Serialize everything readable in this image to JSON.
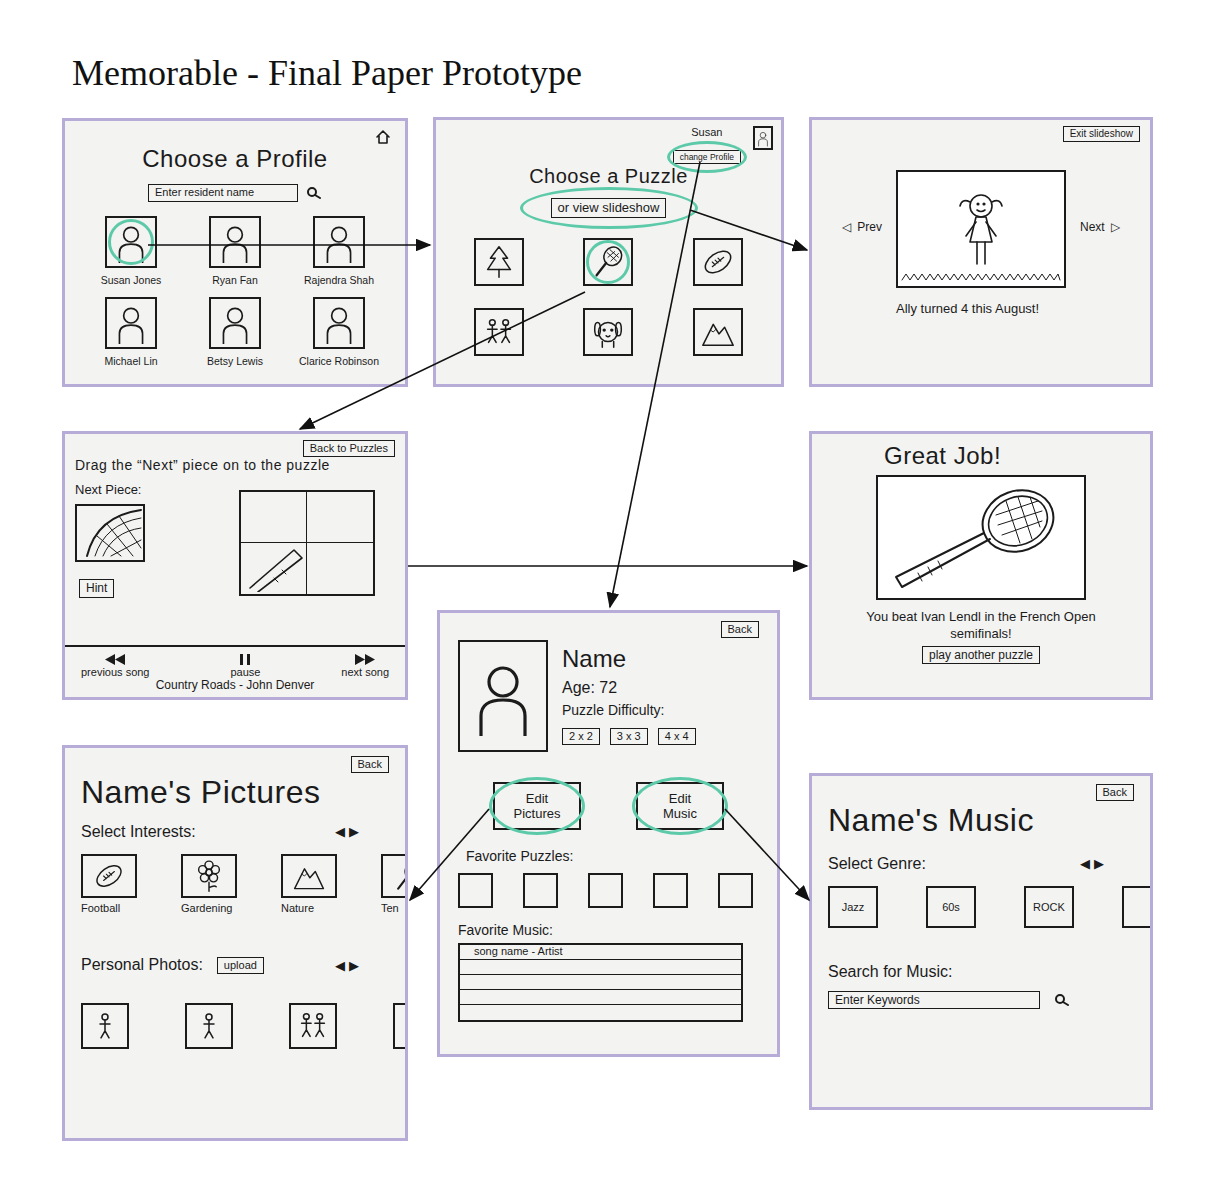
{
  "title": "Memorable - Final Paper Prototype",
  "profiles_screen": {
    "heading": "Choose a Profile",
    "search_placeholder": "Enter resident name",
    "profiles": [
      {
        "name": "Susan Jones",
        "highlighted": true
      },
      {
        "name": "Ryan Fan",
        "highlighted": false
      },
      {
        "name": "Rajendra Shah",
        "highlighted": false
      },
      {
        "name": "Michael Lin",
        "highlighted": false
      },
      {
        "name": "Betsy Lewis",
        "highlighted": false
      },
      {
        "name": "Clarice Robinson",
        "highlighted": false
      }
    ]
  },
  "puzzles_screen": {
    "user": "Susan",
    "change_profile": {
      "label": "change Profile",
      "highlighted": true
    },
    "heading": "Choose a Puzzle",
    "slideshow_link": {
      "label": "or view slideshow",
      "highlighted": true
    },
    "puzzles": [
      {
        "kind": "tree",
        "highlighted": false
      },
      {
        "kind": "tennis",
        "highlighted": true
      },
      {
        "kind": "football",
        "highlighted": false
      },
      {
        "kind": "people",
        "highlighted": false
      },
      {
        "kind": "dog",
        "highlighted": false
      },
      {
        "kind": "mountain",
        "highlighted": false
      }
    ]
  },
  "slideshow_screen": {
    "exit": "Exit slideshow",
    "prev": {
      "glyph": "◁",
      "label": "Prev"
    },
    "next": {
      "label": "Next",
      "glyph": "▷"
    },
    "caption": "Ally turned 4 this August!"
  },
  "puzzle_screen": {
    "back": "Back to Puzzles",
    "instruction": "Drag the “Next” piece on to the puzzle",
    "next_piece_label": "Next Piece:",
    "hint": "Hint",
    "player": {
      "controls": [
        {
          "kind": "previous",
          "label": "previous song"
        },
        {
          "kind": "pause",
          "label": "pause"
        },
        {
          "kind": "next",
          "label": "next song"
        }
      ],
      "now_playing": "Country Roads - John Denver"
    }
  },
  "success_screen": {
    "heading": "Great Job!",
    "caption": "You beat Ivan Lendl in the French Open semifinals!",
    "button": "play another puzzle"
  },
  "profile_screen": {
    "back": "Back",
    "name": "Name",
    "age": "Age: 72",
    "difficulty_label": "Puzzle Difficulty:",
    "difficulties": [
      "2 x 2",
      "3 x 3",
      "4 x 4"
    ],
    "edit_buttons": [
      {
        "label": "Edit Pictures",
        "highlighted": true
      },
      {
        "label": "Edit Music",
        "highlighted": true
      }
    ],
    "favorite_puzzles_label": "Favorite Puzzles:",
    "favorite_puzzles": [
      {
        "filled": false
      },
      {
        "filled": false
      },
      {
        "filled": false
      },
      {
        "filled": false
      },
      {
        "filled": false
      }
    ],
    "favorite_music_label": "Favorite Music:",
    "favorite_music": [
      "song name - Artist",
      "",
      "",
      "",
      ""
    ]
  },
  "pictures_screen": {
    "back": "Back",
    "heading": "Name's Pictures",
    "interests_label": "Select Interests:",
    "pager": [
      "◀",
      "▶"
    ],
    "interests": [
      {
        "kind": "football",
        "label": "Football"
      },
      {
        "kind": "flower",
        "label": "Gardening"
      },
      {
        "kind": "mountain",
        "label": "Nature"
      },
      {
        "kind": "tennis",
        "label": "Ten"
      }
    ],
    "photos_label": "Personal Photos:",
    "upload": "upload",
    "photos_pager": [
      "◀",
      "▶"
    ],
    "photos": [
      {
        "kind": "single"
      },
      {
        "kind": "single"
      },
      {
        "kind": "pair"
      },
      {
        "kind": "single"
      }
    ]
  },
  "music_screen": {
    "back": "Back",
    "heading": "Name's Music",
    "genre_label": "Select Genre:",
    "pager": [
      "◀",
      "▶"
    ],
    "genres": [
      "Jazz",
      "60s",
      "ROCK",
      ""
    ],
    "search_label": "Search for Music:",
    "search_placeholder": "Enter Keywords"
  }
}
